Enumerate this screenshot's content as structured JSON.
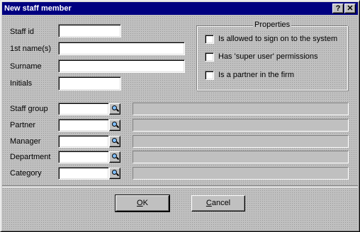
{
  "window": {
    "title": "New staff member",
    "help_glyph": "?",
    "close_glyph": "✕"
  },
  "fields": {
    "staff_id": {
      "label": "Staff id",
      "value": ""
    },
    "first_names": {
      "label": "1st name(s)",
      "value": ""
    },
    "surname": {
      "label": "Surname",
      "value": ""
    },
    "initials": {
      "label": "Initials",
      "value": ""
    }
  },
  "lookups": [
    {
      "label": "Staff group",
      "code": "",
      "description": ""
    },
    {
      "label": "Partner",
      "code": "",
      "description": ""
    },
    {
      "label": "Manager",
      "code": "",
      "description": ""
    },
    {
      "label": "Department",
      "code": "",
      "description": ""
    },
    {
      "label": "Category",
      "code": "",
      "description": ""
    }
  ],
  "properties": {
    "title": "Properties",
    "options": [
      {
        "label": "Is allowed to sign on to the system",
        "checked": false
      },
      {
        "label": "Has 'super user' permissions",
        "checked": false
      },
      {
        "label": "Is a partner in the firm",
        "checked": false
      }
    ]
  },
  "buttons": {
    "ok": {
      "mnemonic": "O",
      "rest": "K"
    },
    "cancel": {
      "mnemonic": "C",
      "rest": "ancel"
    }
  },
  "icons": {
    "lookup": "magnifier-icon",
    "help": "help-icon",
    "close": "close-icon"
  }
}
